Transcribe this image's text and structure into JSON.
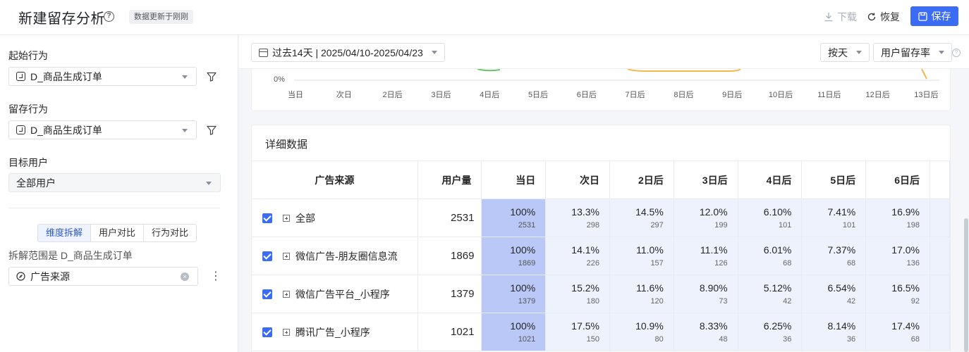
{
  "header": {
    "title": "新建留存分析",
    "update_badge": "数据更新于刚刚",
    "download_label": "下载",
    "restore_label": "恢复",
    "save_label": "保存"
  },
  "left": {
    "start_label": "起始行为",
    "start_value": "D_商品生成订单",
    "retain_label": "留存行为",
    "retain_value": "D_商品生成订单",
    "target_label": "目标用户",
    "target_value": "全部用户",
    "tabs": [
      "维度拆解",
      "用户对比",
      "行为对比"
    ],
    "range_text": "拆解范围是 D_商品生成订单",
    "dimension_value": "广告来源"
  },
  "toolbar": {
    "date_range": "过去14天 | 2025/04/10-2025/04/23",
    "granularity": "按天",
    "metric": "用户留存率"
  },
  "chart": {
    "y_label": "0%",
    "x_ticks": [
      "当日",
      "次日",
      "2日后",
      "3日后",
      "4日后",
      "5日后",
      "6日后",
      "7日后",
      "8日后",
      "9日后",
      "10日后",
      "11日后",
      "12日后",
      "13日后"
    ]
  },
  "detail": {
    "title": "详细数据",
    "columns": [
      "广告来源",
      "用户量",
      "当日",
      "次日",
      "2日后",
      "3日后",
      "4日后",
      "5日后",
      "6日后"
    ],
    "rows": [
      {
        "source": "全部",
        "users": "2531",
        "cells": [
          [
            "100%",
            "2531"
          ],
          [
            "13.3%",
            "298"
          ],
          [
            "14.5%",
            "297"
          ],
          [
            "12.0%",
            "199"
          ],
          [
            "6.10%",
            "101"
          ],
          [
            "7.41%",
            "101"
          ],
          [
            "16.9%",
            "198"
          ]
        ]
      },
      {
        "source": "微信广告-朋友圈信息流",
        "users": "1869",
        "cells": [
          [
            "100%",
            "1869"
          ],
          [
            "14.1%",
            "226"
          ],
          [
            "11.0%",
            "157"
          ],
          [
            "11.1%",
            "126"
          ],
          [
            "6.01%",
            "68"
          ],
          [
            "7.37%",
            "68"
          ],
          [
            "17.0%",
            "136"
          ]
        ]
      },
      {
        "source": "微信广告平台_小程序",
        "users": "1379",
        "cells": [
          [
            "100%",
            "1379"
          ],
          [
            "15.2%",
            "180"
          ],
          [
            "11.6%",
            "120"
          ],
          [
            "8.90%",
            "73"
          ],
          [
            "5.12%",
            "42"
          ],
          [
            "6.54%",
            "42"
          ],
          [
            "16.5%",
            "92"
          ]
        ]
      },
      {
        "source": "腾讯广告_小程序",
        "users": "1021",
        "cells": [
          [
            "100%",
            "1021"
          ],
          [
            "17.5%",
            "150"
          ],
          [
            "10.9%",
            "80"
          ],
          [
            "8.33%",
            "48"
          ],
          [
            "6.25%",
            "36"
          ],
          [
            "8.14%",
            "36"
          ],
          [
            "17.4%",
            "68"
          ]
        ]
      }
    ]
  },
  "colors": {
    "accent": "#3b6cf6",
    "day0_cell": "#b9c8f7",
    "rate_cell": "#eef2fd"
  }
}
